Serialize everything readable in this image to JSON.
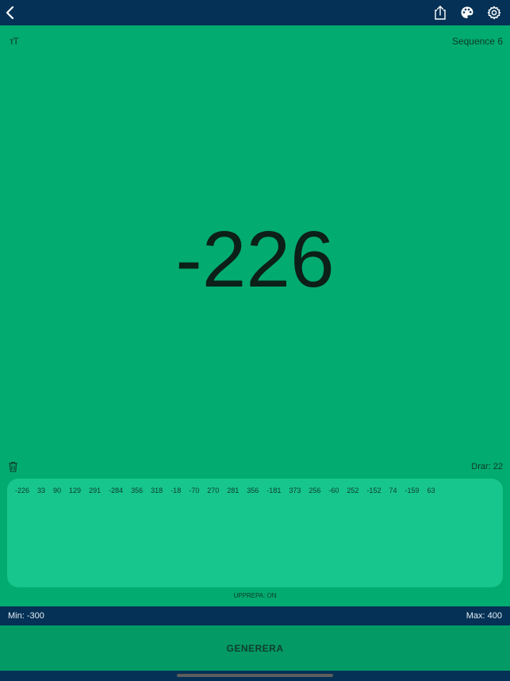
{
  "header": {
    "back_icon": "chevron-left-icon",
    "share_icon": "share-icon",
    "palette_icon": "palette-icon",
    "settings_icon": "gear-icon"
  },
  "display": {
    "font_toggle": "ᴛT",
    "sequence_label": "Sequence 6",
    "current_number": "-226"
  },
  "history": {
    "clear_icon": "trash-icon",
    "draw_count": "Drar: 22",
    "numbers": [
      "-226",
      "33",
      "90",
      "129",
      "291",
      "-284",
      "356",
      "318",
      "-18",
      "-70",
      "270",
      "281",
      "356",
      "-181",
      "373",
      "256",
      "-60",
      "252",
      "-152",
      "74",
      "-159",
      "63"
    ],
    "repeat_status": "UPPREPA: ON"
  },
  "range": {
    "min_label": "Min: -300",
    "max_label": "Max: 400"
  },
  "actions": {
    "generate_label": "GENERERA"
  },
  "colors": {
    "background": "#02ab6f",
    "navbar": "#043155",
    "panel": "#17c68c",
    "button": "#049a66"
  }
}
